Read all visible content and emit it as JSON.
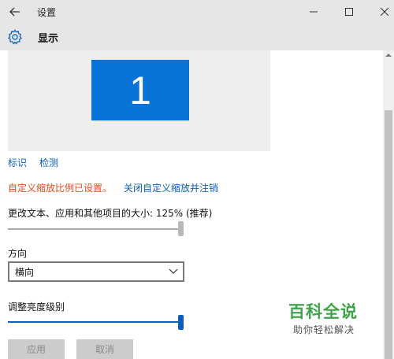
{
  "window": {
    "title": "设置",
    "controls": {
      "minimize_icon": "minimize-icon",
      "maximize_icon": "maximize-icon",
      "close_icon": "close-icon"
    },
    "back_icon": "back-arrow-icon"
  },
  "header": {
    "icon": "gear-icon",
    "title": "显示"
  },
  "display": {
    "monitor_number": "1",
    "identify_link": "标识",
    "detect_link": "检测"
  },
  "custom_scaling": {
    "warning": "自定义缩放比例已设置。",
    "turn_off_link": "关闭自定义缩放并注销"
  },
  "scale": {
    "label": "更改文本、应用和其他项目的大小: 125% (推荐)",
    "value_percent": 125
  },
  "orientation": {
    "label": "方向",
    "selected": "横向"
  },
  "brightness": {
    "label": "调整亮度级别",
    "level": 1.0
  },
  "buttons": {
    "apply": "应用",
    "cancel": "取消"
  },
  "watermark": {
    "title": "百科全说",
    "subtitle": "助你轻松解决"
  },
  "colors": {
    "accent": "#0a73d8",
    "warning": "#e34a1c",
    "link": "#0a5fbd",
    "watermark": "#3ea34a"
  }
}
